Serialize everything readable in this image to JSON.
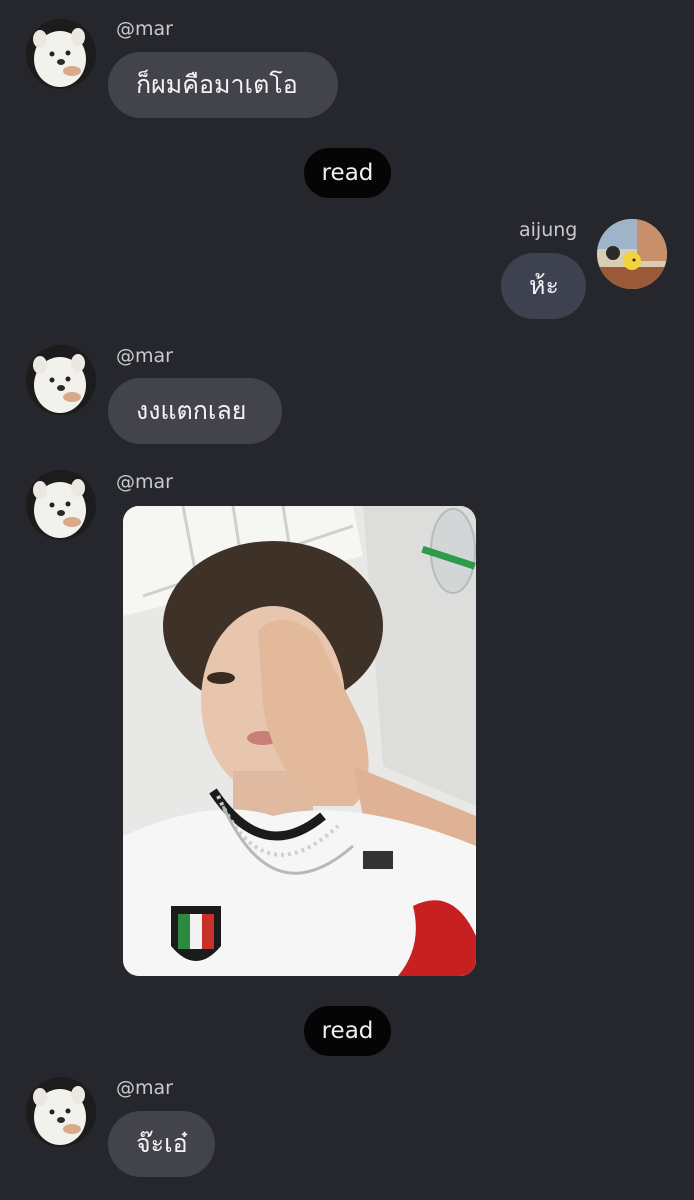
{
  "messages": [
    {
      "sender": "@mar",
      "text": "ก็ผมคือมาเตโอ"
    },
    {
      "read_label": "read"
    },
    {
      "sender": "aijung",
      "text": "ห้ะ"
    },
    {
      "sender": "@mar",
      "text": "งงแตกเลย"
    },
    {
      "sender": "@mar",
      "image": "selfie-photo"
    },
    {
      "read_label": "read"
    },
    {
      "sender": "@mar",
      "text": "จ๊ะเอ๋"
    }
  ],
  "colors": {
    "background": "#26272c",
    "incoming_bubble": "#43444b",
    "outgoing_bubble": "#3d4150",
    "read_pill": "#050506"
  }
}
